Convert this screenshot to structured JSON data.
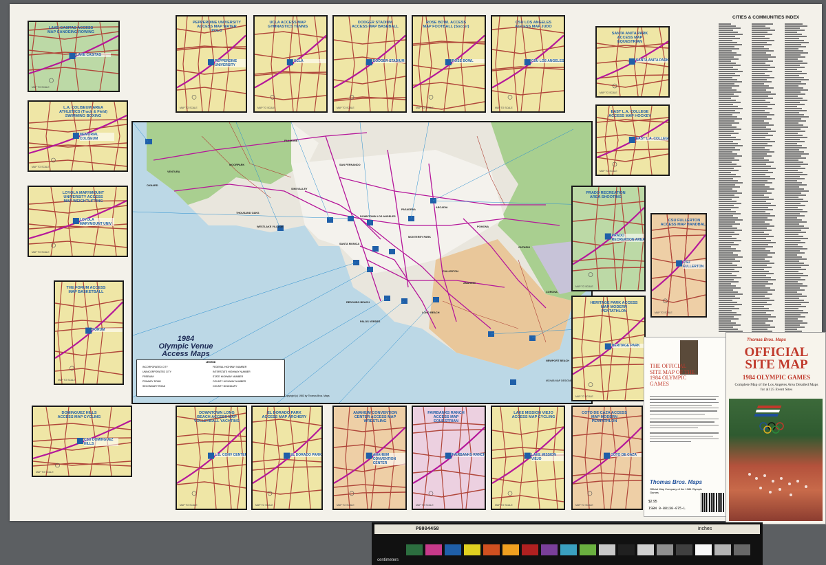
{
  "main": {
    "title_line1": "1984",
    "title_line2": "Olympic Venue",
    "title_line3": "Access Maps",
    "copyright": "Copyright (c) 1983 by Thomas Bros. Maps",
    "credit": "MCNAB MAP DESIGNERS"
  },
  "panels": [
    {
      "id": "lake-casitas",
      "label": "LAKE CASITAS ACCESS MAP CANOEING ROWING",
      "area": "LAKE CASITAS",
      "foot": "MAP TO SCALE"
    },
    {
      "id": "pepperdine",
      "label": "PEPPERDINE UNIVERSITY ACCESS MAP WATER POLO",
      "area": "PEPPERDINE UNIVERSITY",
      "foot": "MAP TO SCALE"
    },
    {
      "id": "ucla",
      "label": "UCLA ACCESS MAP GYMNASTICS TENNIS",
      "area": "UCLA",
      "foot": "MAP TO SCALE"
    },
    {
      "id": "dodger",
      "label": "DODGER STADIUM ACCESS MAP BASEBALL",
      "area": "DODGER STADIUM",
      "foot": "MAP TO SCALE"
    },
    {
      "id": "rose-bowl",
      "label": "ROSE BOWL ACCESS MAP FOOTBALL (Soccer)",
      "area": "ROSE BOWL",
      "foot": "MAP TO SCALE"
    },
    {
      "id": "csu-la",
      "label": "CSU LOS ANGELES ACCESS MAP JUDO",
      "area": "CSU LOS ANGELES",
      "foot": "MAP TO SCALE"
    },
    {
      "id": "santa-anita",
      "label": "SANTA ANITA PARK ACCESS MAP EQUESTRIAN",
      "area": "SANTA ANITA PARK",
      "foot": "MAP TO SCALE"
    },
    {
      "id": "coliseum",
      "label": "L.A. COLISEUM AREA ATHLETICS (Track & Field) SWIMMING BOXING",
      "area": "MEMORIAL COLISEUM",
      "foot": "MAP TO SCALE"
    },
    {
      "id": "east-la",
      "label": "EAST L.A. COLLEGE ACCESS MAP HOCKEY",
      "area": "EAST L.A. COLLEGE",
      "foot": "MAP TO SCALE"
    },
    {
      "id": "loyola",
      "label": "LOYOLA MARYMOUNT UNIVERSITY ACCESS MAP WEIGHTLIFTING",
      "area": "LOYOLA MARYMOUNT UNIV",
      "foot": "MAP TO SCALE"
    },
    {
      "id": "prado",
      "label": "PRADO RECREATION AREA SHOOTING",
      "area": "PRADO RECREATION AREA",
      "foot": "MAP TO SCALE"
    },
    {
      "id": "csu-fullerton",
      "label": "CSU FULLERTON ACCESS MAP HANDBALL",
      "area": "CSU FULLERTON",
      "foot": "MAP TO SCALE"
    },
    {
      "id": "forum",
      "label": "THE FORUM ACCESS MAP BASKETBALL",
      "area": "FORUM",
      "foot": "MAP TO SCALE"
    },
    {
      "id": "heritage",
      "label": "HERITAGE PARK ACCESS MAP MODERN PENTATHLON",
      "area": "HERITAGE PARK",
      "foot": "MAP TO SCALE"
    },
    {
      "id": "csu-dominguez",
      "label": "DOMINGUEZ HILLS ACCESS MAP CYCLING",
      "area": "CSU DOMINGUEZ HILLS",
      "foot": "MAP TO SCALE"
    },
    {
      "id": "long-beach",
      "label": "DOWNTOWN LONG BEACH ACCESS MAP VOLLEYBALL YACHTING",
      "area": "L.B. CONV CENTER",
      "foot": "MAP TO SCALE"
    },
    {
      "id": "el-dorado",
      "label": "EL DORADO PARK ACCESS MAP ARCHERY",
      "area": "EL DORADO PARK",
      "foot": "MAP TO SCALE"
    },
    {
      "id": "anaheim",
      "label": "ANAHEIM CONVENTION CENTER ACCESS MAP WRESTLING",
      "area": "ANAHEIM CONVENTION CENTER",
      "foot": "MAP TO SCALE"
    },
    {
      "id": "fairbanks",
      "label": "FAIRBANKS RANCH ACCESS MAP EQUESTRIAN",
      "area": "FAIRBANKS RANCH",
      "foot": "MAP TO SCALE"
    },
    {
      "id": "mission-viejo",
      "label": "LAKE MISSION VIEJO ACCESS MAP CYCLING",
      "area": "LAKE MISSION VIEJO",
      "foot": "MAP TO SCALE"
    },
    {
      "id": "coto-de-caza",
      "label": "COTO DE CAZA ACCESS MAP MODERN PENTATHLON",
      "area": "COTO DE CAZA",
      "foot": "MAP TO SCALE"
    }
  ],
  "places": [
    "VENTURA",
    "OXNARD",
    "MOORPARK",
    "FILLMORE",
    "SIMI VALLEY",
    "THOUSAND OAKS",
    "WESTLAKE VILLAGE",
    "SANTA MONICA",
    "PASADENA",
    "ARCADIA",
    "POMONA",
    "ONTARIO",
    "DOWNTOWN LOS ANGELES",
    "FULLERTON",
    "ANAHEIM",
    "CORONA",
    "REDONDO BEACH",
    "LONG BEACH",
    "PALOS VERDES",
    "NEWPORT BEACH",
    "SAN FERNANDO",
    "MONTEREY PARK"
  ],
  "legend": {
    "title": "LEGEND",
    "items": [
      "INCORPORATED CITY",
      "UNINCORPORATED CITY",
      "FREEWAY",
      "PRIMARY ROAD",
      "SECONDARY ROAD",
      "FEDERAL HIGHWAY NUMBER",
      "INTERSTATE HIGHWAY NUMBER",
      "STATE HIGHWAY NUMBER",
      "COUNTY HIGHWAY NUMBER",
      "COUNTY BOUNDARY"
    ]
  },
  "index": {
    "title": "CITIES & COMMUNITIES INDEX"
  },
  "booklet": {
    "left_title": "THE OFFICIAL SITE MAP OF THE 1984 OLYMPIC GAMES",
    "left_brand": "Thomas Bros. Maps",
    "left_sub": "Official Map Company of the 1984 Olympic Games",
    "price": "$2.95",
    "isbn": "ISBN 0-88130-075-L",
    "right_brand": "Thomas Bros. Maps",
    "right_title_1": "OFFICIAL",
    "right_title_2": "SITE MAP",
    "right_subtitle": "1984 OLYMPIC GAMES",
    "right_desc": "Complete Map of the Los Angeles Area Detailed Maps for all 25 Event Sites"
  },
  "ruler": {
    "id_text": "P0004458",
    "unit_inches": "inches",
    "unit_cm": "centimeters"
  },
  "colors": {
    "panel_yellow": "#efe6a6",
    "panel_green": "#bcd9a6",
    "panel_tan": "#eecfa6",
    "panel_pink": "#ecd0e0",
    "water": "#bcd8e6",
    "freeway": "#b5179a",
    "road": "#b0463a",
    "title_blue": "#1f5fa8"
  }
}
